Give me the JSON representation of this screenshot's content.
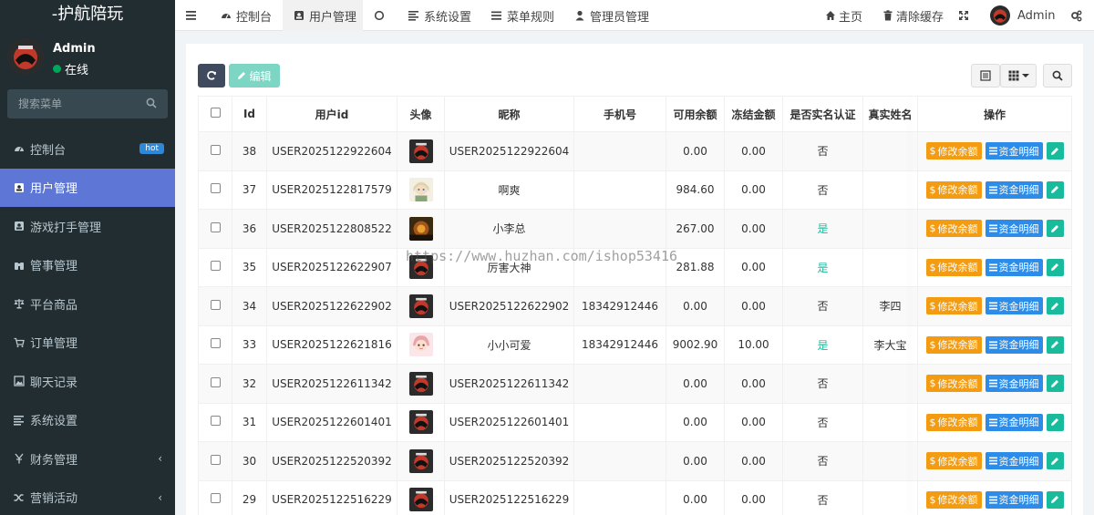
{
  "brand": "-护航陪玩",
  "user": {
    "name": "Admin",
    "status": "在线"
  },
  "search": {
    "placeholder": "搜索菜单"
  },
  "menu": [
    {
      "label": "控制台",
      "icon": "dashboard-icon",
      "badge": "hot"
    },
    {
      "label": "用户管理",
      "icon": "user-card-icon",
      "active": true
    },
    {
      "label": "游戏打手管理",
      "icon": "user-card-icon"
    },
    {
      "label": "管事管理",
      "icon": "binoculars-icon"
    },
    {
      "label": "平台商品",
      "icon": "balance-scale-icon"
    },
    {
      "label": "订单管理",
      "icon": "cart-icon"
    },
    {
      "label": "聊天记录",
      "icon": "image-icon"
    },
    {
      "label": "系统设置",
      "icon": "list-icon"
    },
    {
      "label": "财务管理",
      "icon": "yen-icon",
      "chevron": "‹"
    },
    {
      "label": "营销活动",
      "icon": "shuffle-icon",
      "chevron": "‹"
    }
  ],
  "topnav": [
    {
      "label": "",
      "icon": "hamburger-icon"
    },
    {
      "label": "控制台",
      "icon": "dashboard-icon"
    },
    {
      "label": "用户管理",
      "icon": "user-card-icon",
      "active": true
    },
    {
      "label": "",
      "icon": "circle-icon"
    },
    {
      "label": "系统设置",
      "icon": "list-icon"
    },
    {
      "label": "菜单规则",
      "icon": "bars-icon"
    },
    {
      "label": "管理员管理",
      "icon": "user-icon"
    }
  ],
  "topright": {
    "home": "主页",
    "clear_cache": "清除缓存",
    "admin": "Admin"
  },
  "toolbar": {
    "edit_label": "编辑"
  },
  "table": {
    "headers": [
      "Id",
      "用户id",
      "头像",
      "昵称",
      "手机号",
      "可用余额",
      "冻结金额",
      "是否实名认证",
      "真实姓名",
      "操作"
    ],
    "buttons": {
      "modify": "修改余额",
      "detail": "资金明细"
    },
    "rows": [
      {
        "id": "38",
        "uid": "USER2025122922604",
        "avatar": "logo",
        "nick": "USER2025122922604",
        "phone": "",
        "balance": "0.00",
        "frozen": "0.00",
        "verified": "否",
        "realname": ""
      },
      {
        "id": "37",
        "uid": "USER2025122817579",
        "avatar": "anime1",
        "nick": "啊爽",
        "phone": "",
        "balance": "984.60",
        "frozen": "0.00",
        "verified": "否",
        "realname": ""
      },
      {
        "id": "36",
        "uid": "USER2025122808522",
        "avatar": "dark",
        "nick": "小李总",
        "phone": "",
        "balance": "267.00",
        "frozen": "0.00",
        "verified": "是",
        "realname": ""
      },
      {
        "id": "35",
        "uid": "USER2025122622907",
        "avatar": "logo",
        "nick": "厉害大神",
        "phone": "",
        "balance": "281.88",
        "frozen": "0.00",
        "verified": "是",
        "realname": ""
      },
      {
        "id": "34",
        "uid": "USER2025122622902",
        "avatar": "logo",
        "nick": "USER2025122622902",
        "phone": "18342912446",
        "balance": "0.00",
        "frozen": "0.00",
        "verified": "否",
        "realname": "李四"
      },
      {
        "id": "33",
        "uid": "USER2025122621816",
        "avatar": "anime2",
        "nick": "小小可爱",
        "phone": "18342912446",
        "balance": "9002.90",
        "frozen": "10.00",
        "verified": "是",
        "realname": "李大宝"
      },
      {
        "id": "32",
        "uid": "USER2025122611342",
        "avatar": "logo",
        "nick": "USER2025122611342",
        "phone": "",
        "balance": "0.00",
        "frozen": "0.00",
        "verified": "否",
        "realname": ""
      },
      {
        "id": "31",
        "uid": "USER2025122601401",
        "avatar": "logo",
        "nick": "USER2025122601401",
        "phone": "",
        "balance": "0.00",
        "frozen": "0.00",
        "verified": "否",
        "realname": ""
      },
      {
        "id": "30",
        "uid": "USER2025122520392",
        "avatar": "logo",
        "nick": "USER2025122520392",
        "phone": "",
        "balance": "0.00",
        "frozen": "0.00",
        "verified": "否",
        "realname": ""
      },
      {
        "id": "29",
        "uid": "USER2025122516229",
        "avatar": "logo",
        "nick": "USER2025122516229",
        "phone": "",
        "balance": "0.00",
        "frozen": "0.00",
        "verified": "否",
        "realname": ""
      }
    ]
  },
  "watermark": "https://www.huzhan.com/ishop53416",
  "colors": {
    "sidebar": "#222d32",
    "active": "#5e77d6",
    "orange": "#f39c12",
    "blue": "#2d8ce8",
    "green": "#18bc9c"
  }
}
